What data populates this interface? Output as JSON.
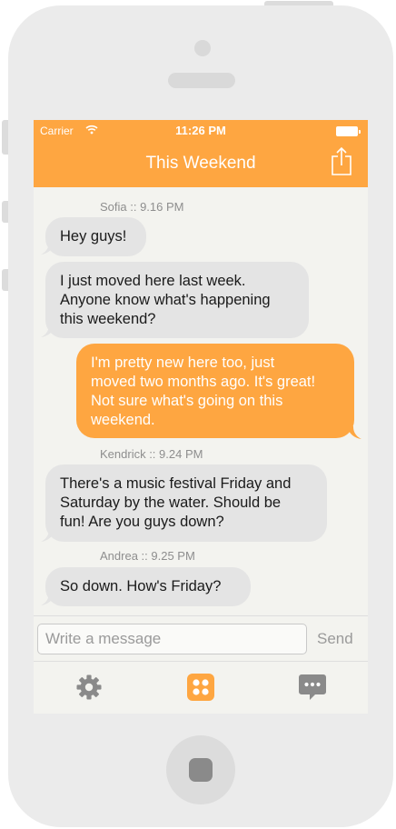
{
  "status_bar": {
    "carrier": "Carrier",
    "time": "11:26 PM"
  },
  "header": {
    "title": "This Weekend"
  },
  "messages": [
    {
      "sender": "Sofia :: 9.16 PM",
      "lines": [
        "Hey guys!"
      ],
      "type": "received"
    },
    {
      "sender": "",
      "lines": [
        "I just moved here last week.",
        "Anyone know what's happening",
        "this weekend?"
      ],
      "type": "received"
    },
    {
      "sender": "",
      "lines": [
        "I'm pretty new here too, just",
        "moved two months ago. It's great!",
        "Not sure what's going on this",
        "weekend."
      ],
      "type": "sent"
    },
    {
      "sender": "Kendrick :: 9.24 PM",
      "lines": [
        "There's a music festival Friday and",
        "Saturday by the water. Should be",
        "fun! Are you guys down?"
      ],
      "type": "received"
    },
    {
      "sender": "Andrea :: 9.25 PM",
      "lines": [
        "So down. How's Friday?"
      ],
      "type": "received"
    }
  ],
  "composer": {
    "placeholder": "Write a message",
    "send_label": "Send"
  },
  "tabs": [
    {
      "icon": "gear-icon",
      "active": false
    },
    {
      "icon": "grid-dots-icon",
      "active": true
    },
    {
      "icon": "chat-bubble-icon",
      "active": false
    }
  ],
  "colors": {
    "accent": "#fea641",
    "bubble_received": "#e4e4e4",
    "background": "#f3f3ef",
    "inactive_icon": "#8a8a8a"
  }
}
